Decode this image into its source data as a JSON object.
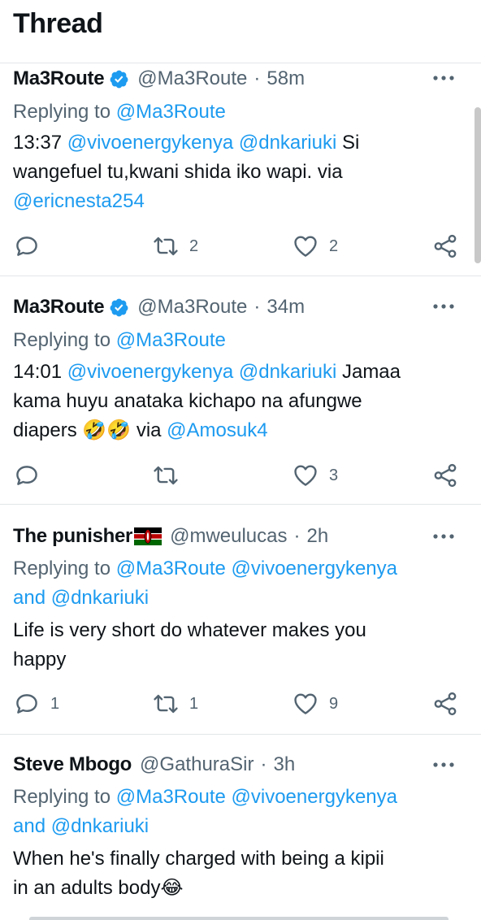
{
  "header": {
    "title": "Thread"
  },
  "colors": {
    "accent": "#1d9bf0",
    "muted": "#536471",
    "text": "#0f1419"
  },
  "tweets": [
    {
      "name": "Ma3Route",
      "verified": true,
      "handle": "@Ma3Route",
      "time": "58m",
      "replying_prefix": "Replying to ",
      "replying_to": "@Ma3Route",
      "replying_and": "",
      "body_lines": [
        [
          {
            "t": "13:37 "
          },
          {
            "t": "@vivoenergykenya",
            "link": true
          },
          {
            "t": " "
          },
          {
            "t": "@dnkariuki",
            "link": true
          },
          {
            "t": " Si"
          }
        ],
        [
          {
            "t": "wangefuel tu,kwani shida iko wapi. via"
          }
        ],
        [
          {
            "t": "@ericnesta254",
            "link": true
          }
        ]
      ],
      "counts": {
        "reply": "",
        "retweet": "2",
        "like": "2"
      }
    },
    {
      "name": "Ma3Route",
      "verified": true,
      "handle": "@Ma3Route",
      "time": "34m",
      "replying_prefix": "Replying to ",
      "replying_to": "@Ma3Route",
      "replying_and": "",
      "body_lines": [
        [
          {
            "t": "14:01 "
          },
          {
            "t": "@vivoenergykenya",
            "link": true
          },
          {
            "t": " "
          },
          {
            "t": "@dnkariuki",
            "link": true
          },
          {
            "t": " Jamaa"
          }
        ],
        [
          {
            "t": "kama huyu anataka kichapo na afungwe"
          }
        ],
        [
          {
            "t": "diapers 🤣🤣 via "
          },
          {
            "t": "@Amosuk4",
            "link": true
          }
        ]
      ],
      "counts": {
        "reply": "",
        "retweet": "",
        "like": "3"
      }
    },
    {
      "name": "The punisher",
      "flag": "kenya-flag",
      "handle": "@mweulucas",
      "time": "2h",
      "replying_prefix": "Replying to ",
      "replying_to": "@Ma3Route @vivoenergykenya",
      "replying_and": "and @dnkariuki",
      "body_lines": [
        [
          {
            "t": "Life is very short do whatever makes you"
          }
        ],
        [
          {
            "t": "happy"
          }
        ]
      ],
      "counts": {
        "reply": "1",
        "retweet": "1",
        "like": "9"
      }
    },
    {
      "name": "Steve Mbogo",
      "handle": "@GathuraSir",
      "time": "3h",
      "replying_prefix": "Replying to ",
      "replying_to": "@Ma3Route @vivoenergykenya",
      "replying_and": "and @dnkariuki",
      "body_lines": [
        [
          {
            "t": "When he's finally charged with being a kipii"
          }
        ],
        [
          {
            "t": "in an adults body😂"
          }
        ]
      ]
    }
  ]
}
